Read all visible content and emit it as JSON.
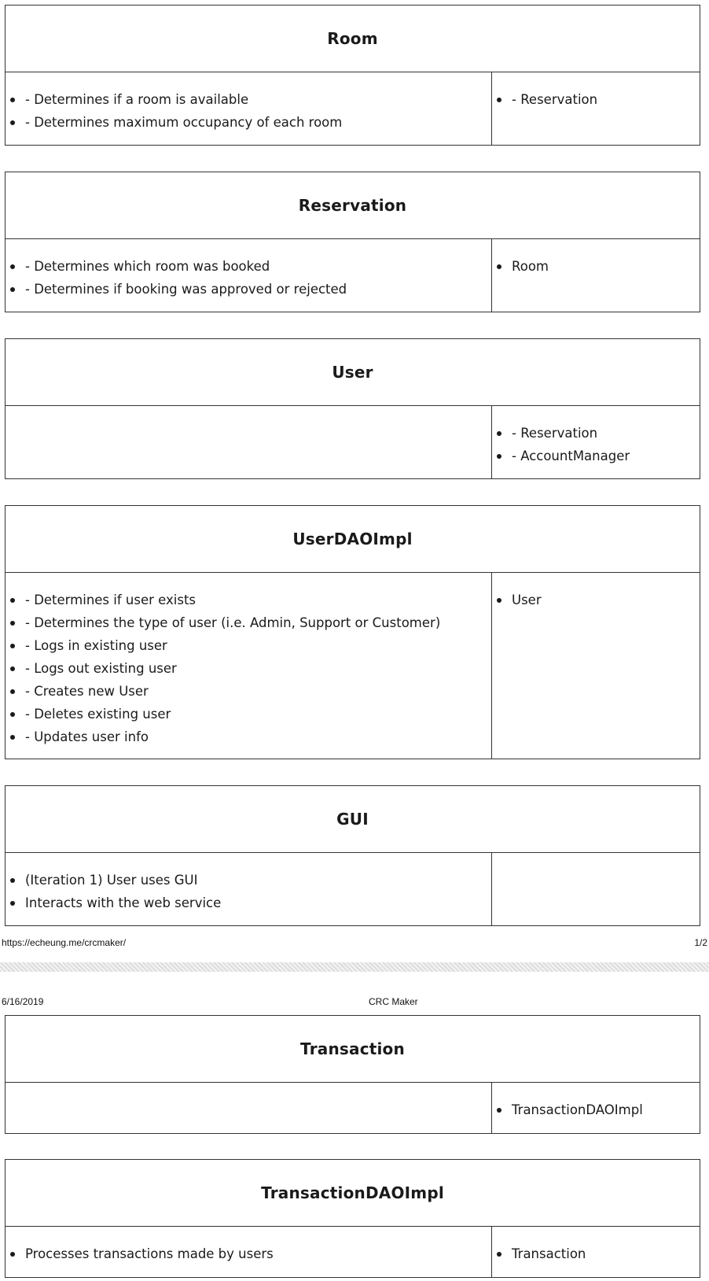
{
  "cards": [
    {
      "title": "Room",
      "responsibilities": [
        "- Determines if a room is available",
        "- Determines maximum occupancy of each room"
      ],
      "collaborators": [
        "- Reservation"
      ]
    },
    {
      "title": "Reservation",
      "responsibilities": [
        "- Determines which room was booked",
        "- Determines if booking was approved or rejected"
      ],
      "collaborators": [
        "Room"
      ]
    },
    {
      "title": "User",
      "responsibilities": [],
      "collaborators": [
        "- Reservation",
        "- AccountManager"
      ]
    },
    {
      "title": "UserDAOImpl",
      "responsibilities": [
        "- Determines if user exists",
        "- Determines the type of user (i.e. Admin, Support or Customer)",
        "- Logs in existing user",
        "- Logs out existing user",
        "- Creates new User",
        "- Deletes existing user",
        "- Updates user info"
      ],
      "collaborators": [
        "User"
      ]
    },
    {
      "title": "GUI",
      "responsibilities": [
        "(Iteration 1) User uses GUI",
        "Interacts with the web service"
      ],
      "collaborators": []
    },
    {
      "title": "Transaction",
      "responsibilities": [],
      "collaborators": [
        "TransactionDAOImpl"
      ]
    },
    {
      "title": "TransactionDAOImpl",
      "responsibilities": [
        "Processes transactions made by users"
      ],
      "collaborators": [
        "Transaction"
      ]
    }
  ],
  "footer": {
    "url": "https://echeung.me/crcmaker/",
    "page": "1/2"
  },
  "header": {
    "date": "6/16/2019",
    "title": "CRC Maker"
  }
}
